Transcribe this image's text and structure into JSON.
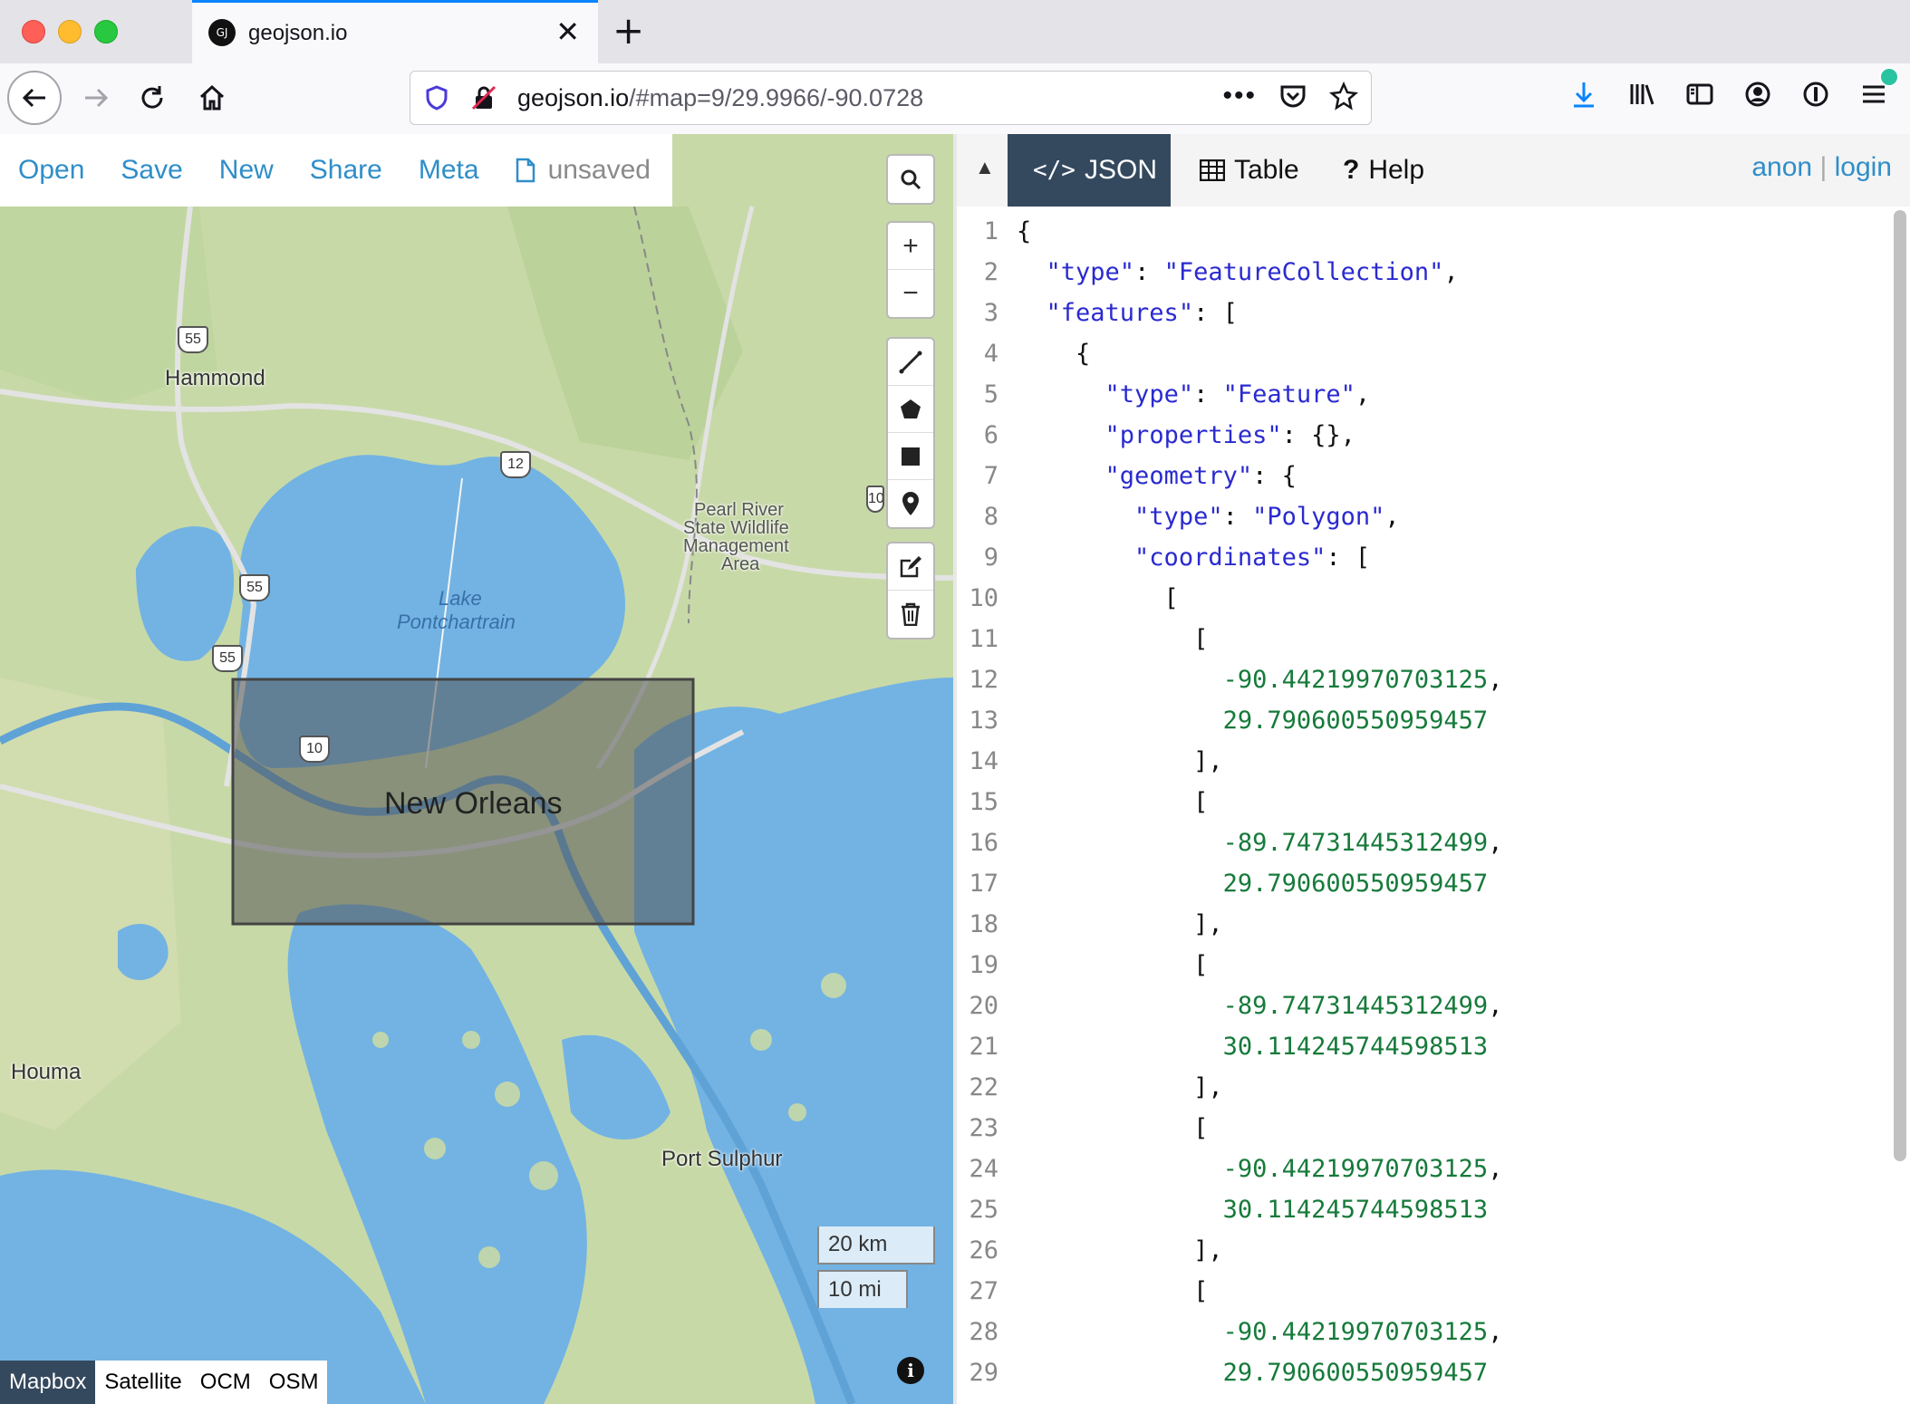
{
  "browser": {
    "tab_title": "geojson.io",
    "favicon_text": "GJ",
    "url_host": "geojson.io",
    "url_path": "/#map=9/29.9966/-90.0728"
  },
  "menu": {
    "open": "Open",
    "save": "Save",
    "new": "New",
    "share": "Share",
    "meta": "Meta",
    "unsaved": "unsaved"
  },
  "map": {
    "labels": {
      "hammond": "Hammond",
      "lake1": "Lake",
      "lake2": "Pontchartrain",
      "pearl1": "Pearl River",
      "pearl2": "State Wildlife",
      "pearl3": "Management",
      "pearl4": "Area",
      "new_orleans": "New Orleans",
      "houma": "Houma",
      "port_sulphur": "Port Sulphur"
    },
    "shields": {
      "i55a": "55",
      "i55b": "55",
      "i55c": "55",
      "i12": "12",
      "i10": "10",
      "i10b": "10"
    },
    "scale_km": "20 km",
    "scale_mi": "10 mi",
    "layers": [
      "Mapbox",
      "Satellite",
      "OCM",
      "OSM"
    ],
    "active_layer": "Mapbox",
    "water_color": "#72b3e3",
    "land_color": "#c8d9a8",
    "selection_color": "#555555"
  },
  "panel": {
    "tabs": {
      "json": "JSON",
      "table": "Table",
      "help": "Help"
    },
    "auth_anon": "anon",
    "auth_sep": "|",
    "auth_login": "login",
    "lines": [
      "{",
      "  \"type\": \"FeatureCollection\",",
      "  \"features\": [",
      "    {",
      "      \"type\": \"Feature\",",
      "      \"properties\": {},",
      "      \"geometry\": {",
      "        \"type\": \"Polygon\",",
      "        \"coordinates\": [",
      "          [",
      "            [",
      "              -90.44219970703125,",
      "              29.790600550959457",
      "            ],",
      "            [",
      "              -89.74731445312499,",
      "              29.790600550959457",
      "            ],",
      "            [",
      "              -89.74731445312499,",
      "              30.114245744598513",
      "            ],",
      "            [",
      "              -90.44219970703125,",
      "              30.114245744598513",
      "            ],",
      "            [",
      "              -90.44219970703125,",
      "              29.790600550959457"
    ]
  }
}
